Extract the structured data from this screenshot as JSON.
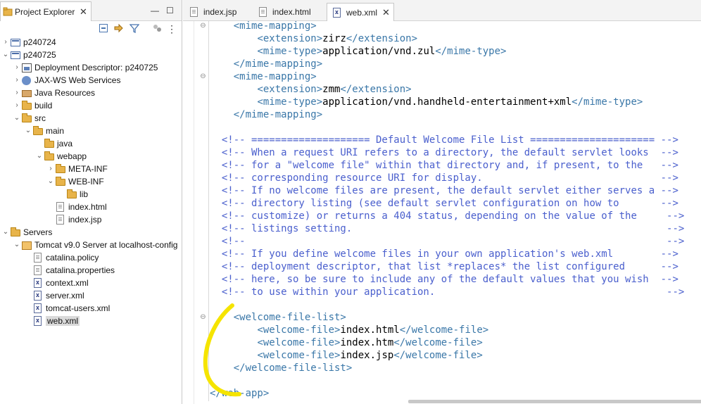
{
  "explorer": {
    "title": "Project Explorer",
    "close": "✕",
    "minimize": "—",
    "maximize": "☐",
    "tree": [
      {
        "label": "p240724",
        "arrow": "›",
        "icon": "project-icon",
        "level": 0
      },
      {
        "label": "p240725",
        "arrow": "⌄",
        "icon": "project-icon",
        "level": 0
      },
      {
        "label": "Deployment Descriptor: p240725",
        "arrow": "›",
        "icon": "deployment-descriptor-icon",
        "level": 1
      },
      {
        "label": "JAX-WS Web Services",
        "arrow": "›",
        "icon": "web-services-icon",
        "level": 1
      },
      {
        "label": "Java Resources",
        "arrow": "›",
        "icon": "java-resources-icon",
        "level": 1
      },
      {
        "label": "build",
        "arrow": "›",
        "icon": "folder-icon",
        "level": 1
      },
      {
        "label": "src",
        "arrow": "⌄",
        "icon": "folder-icon",
        "level": 1
      },
      {
        "label": "main",
        "arrow": "⌄",
        "icon": "folder-icon",
        "level": 2
      },
      {
        "label": "java",
        "arrow": "",
        "icon": "folder-icon",
        "level": 3
      },
      {
        "label": "webapp",
        "arrow": "⌄",
        "icon": "folder-icon",
        "level": 3
      },
      {
        "label": "META-INF",
        "arrow": "›",
        "icon": "folder-icon",
        "level": 4
      },
      {
        "label": "WEB-INF",
        "arrow": "⌄",
        "icon": "folder-icon",
        "level": 4
      },
      {
        "label": "lib",
        "arrow": "",
        "icon": "folder-icon",
        "level": 5
      },
      {
        "label": "index.html",
        "arrow": "",
        "icon": "file-icon",
        "level": 4
      },
      {
        "label": "index.jsp",
        "arrow": "",
        "icon": "file-icon",
        "level": 4
      },
      {
        "label": "Servers",
        "arrow": "⌄",
        "icon": "folder-icon",
        "level": 0
      },
      {
        "label": "Tomcat v9.0 Server at localhost-config",
        "arrow": "⌄",
        "icon": "server-folder-icon",
        "level": 1
      },
      {
        "label": "catalina.policy",
        "arrow": "",
        "icon": "file-icon",
        "level": 2
      },
      {
        "label": "catalina.properties",
        "arrow": "",
        "icon": "file-icon",
        "level": 2
      },
      {
        "label": "context.xml",
        "arrow": "",
        "icon": "xml-file-icon",
        "level": 2
      },
      {
        "label": "server.xml",
        "arrow": "",
        "icon": "xml-file-icon",
        "level": 2
      },
      {
        "label": "tomcat-users.xml",
        "arrow": "",
        "icon": "xml-file-icon",
        "level": 2
      },
      {
        "label": "web.xml",
        "arrow": "",
        "icon": "xml-file-icon",
        "level": 2,
        "selected": true
      }
    ]
  },
  "editor": {
    "tabs": [
      {
        "label": "index.jsp",
        "icon": "file-icon",
        "active": false
      },
      {
        "label": "index.html",
        "icon": "file-icon",
        "active": false
      },
      {
        "label": "web.xml",
        "icon": "xml-file-icon",
        "active": true
      }
    ],
    "tab_close": "✕",
    "fold_marker": "⊖",
    "lines": [
      {
        "indent": "    ",
        "parts": [
          [
            "t",
            "<mime-mapping>"
          ]
        ],
        "fold": true
      },
      {
        "indent": "        ",
        "parts": [
          [
            "t",
            "<extension>"
          ],
          [
            "x",
            "zirz"
          ],
          [
            "t",
            "</extension>"
          ]
        ]
      },
      {
        "indent": "        ",
        "parts": [
          [
            "t",
            "<mime-type>"
          ],
          [
            "x",
            "application/vnd.zul"
          ],
          [
            "t",
            "</mime-type>"
          ]
        ]
      },
      {
        "indent": "    ",
        "parts": [
          [
            "t",
            "</mime-mapping>"
          ]
        ]
      },
      {
        "indent": "    ",
        "parts": [
          [
            "t",
            "<mime-mapping>"
          ]
        ],
        "fold": true
      },
      {
        "indent": "        ",
        "parts": [
          [
            "t",
            "<extension>"
          ],
          [
            "x",
            "zmm"
          ],
          [
            "t",
            "</extension>"
          ]
        ]
      },
      {
        "indent": "        ",
        "parts": [
          [
            "t",
            "<mime-type>"
          ],
          [
            "x",
            "application/vnd.handheld-entertainment+xml"
          ],
          [
            "t",
            "</mime-type>"
          ]
        ]
      },
      {
        "indent": "    ",
        "parts": [
          [
            "t",
            "</mime-mapping>"
          ]
        ]
      },
      {
        "indent": "",
        "parts": []
      },
      {
        "indent": "  ",
        "parts": [
          [
            "c",
            "<!-- ==================== Default Welcome File List ===================== -->"
          ]
        ]
      },
      {
        "indent": "  ",
        "parts": [
          [
            "c",
            "<!-- When a request URI refers to a directory, the default servlet looks  -->"
          ]
        ]
      },
      {
        "indent": "  ",
        "parts": [
          [
            "c",
            "<!-- for a \"welcome file\" within that directory and, if present, to the   -->"
          ]
        ]
      },
      {
        "indent": "  ",
        "parts": [
          [
            "c",
            "<!-- corresponding resource URI for display.                              -->"
          ]
        ]
      },
      {
        "indent": "  ",
        "parts": [
          [
            "c",
            "<!-- If no welcome files are present, the default servlet either serves a -->"
          ]
        ]
      },
      {
        "indent": "  ",
        "parts": [
          [
            "c",
            "<!-- directory listing (see default servlet configuration on how to       -->"
          ]
        ]
      },
      {
        "indent": "  ",
        "parts": [
          [
            "c",
            "<!-- customize) or returns a 404 status, depending on the value of the     -->"
          ]
        ]
      },
      {
        "indent": "  ",
        "parts": [
          [
            "c",
            "<!-- listings setting.                                                     -->"
          ]
        ]
      },
      {
        "indent": "  ",
        "parts": [
          [
            "c",
            "<!--                                                                       -->"
          ]
        ]
      },
      {
        "indent": "  ",
        "parts": [
          [
            "c",
            "<!-- If you define welcome files in your own application's web.xml        -->"
          ]
        ]
      },
      {
        "indent": "  ",
        "parts": [
          [
            "c",
            "<!-- deployment descriptor, that list *replaces* the list configured      -->"
          ]
        ]
      },
      {
        "indent": "  ",
        "parts": [
          [
            "c",
            "<!-- here, so be sure to include any of the default values that you wish  -->"
          ]
        ]
      },
      {
        "indent": "  ",
        "parts": [
          [
            "c",
            "<!-- to use within your application.                                       -->"
          ]
        ]
      },
      {
        "indent": "",
        "parts": []
      },
      {
        "indent": "    ",
        "parts": [
          [
            "t",
            "<welcome-file-list>"
          ]
        ],
        "fold": true
      },
      {
        "indent": "        ",
        "parts": [
          [
            "t",
            "<welcome-file>"
          ],
          [
            "x",
            "index.html"
          ],
          [
            "t",
            "</welcome-file>"
          ]
        ]
      },
      {
        "indent": "        ",
        "parts": [
          [
            "t",
            "<welcome-file>"
          ],
          [
            "x",
            "index.htm"
          ],
          [
            "t",
            "</welcome-file>"
          ]
        ]
      },
      {
        "indent": "        ",
        "parts": [
          [
            "t",
            "<welcome-file>"
          ],
          [
            "x",
            "index.jsp"
          ],
          [
            "t",
            "</welcome-file>"
          ]
        ]
      },
      {
        "indent": "    ",
        "parts": [
          [
            "t",
            "</welcome-file-list>"
          ]
        ]
      },
      {
        "indent": "",
        "parts": []
      },
      {
        "indent": "",
        "parts": [
          [
            "t",
            "</web-app>"
          ]
        ]
      }
    ]
  },
  "colors": {
    "tag": "#3a77a8",
    "comment": "#4a5fcd",
    "annotation": "#f5e400"
  }
}
